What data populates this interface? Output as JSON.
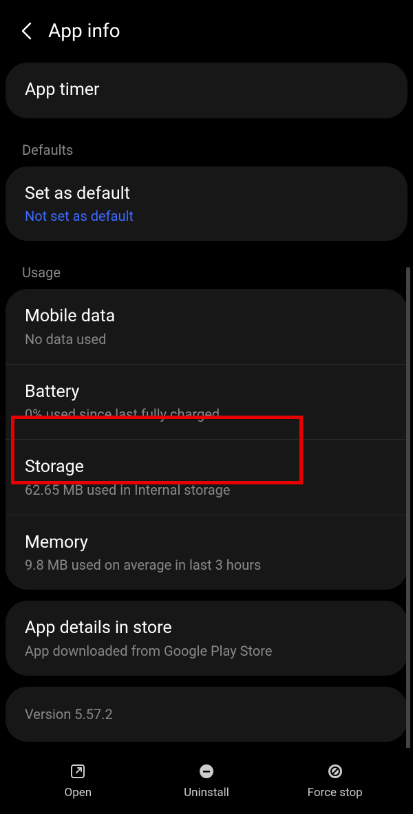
{
  "header": {
    "title": "App info"
  },
  "items": {
    "app_timer": {
      "title": "App timer"
    }
  },
  "sections": {
    "defaults_label": "Defaults",
    "usage_label": "Usage"
  },
  "defaults": {
    "set_default": {
      "title": "Set as default",
      "sub": "Not set as default"
    }
  },
  "usage": {
    "mobile_data": {
      "title": "Mobile data",
      "sub": "No data used"
    },
    "battery": {
      "title": "Battery",
      "sub": "0% used since last fully charged"
    },
    "storage": {
      "title": "Storage",
      "sub": "62.65 MB used in Internal storage"
    },
    "memory": {
      "title": "Memory",
      "sub": "9.8 MB used on average in last 3 hours"
    }
  },
  "store": {
    "title": "App details in store",
    "sub": "App downloaded from Google Play Store"
  },
  "version": "Version 5.57.2",
  "nav": {
    "open": "Open",
    "uninstall": "Uninstall",
    "force_stop": "Force stop"
  }
}
